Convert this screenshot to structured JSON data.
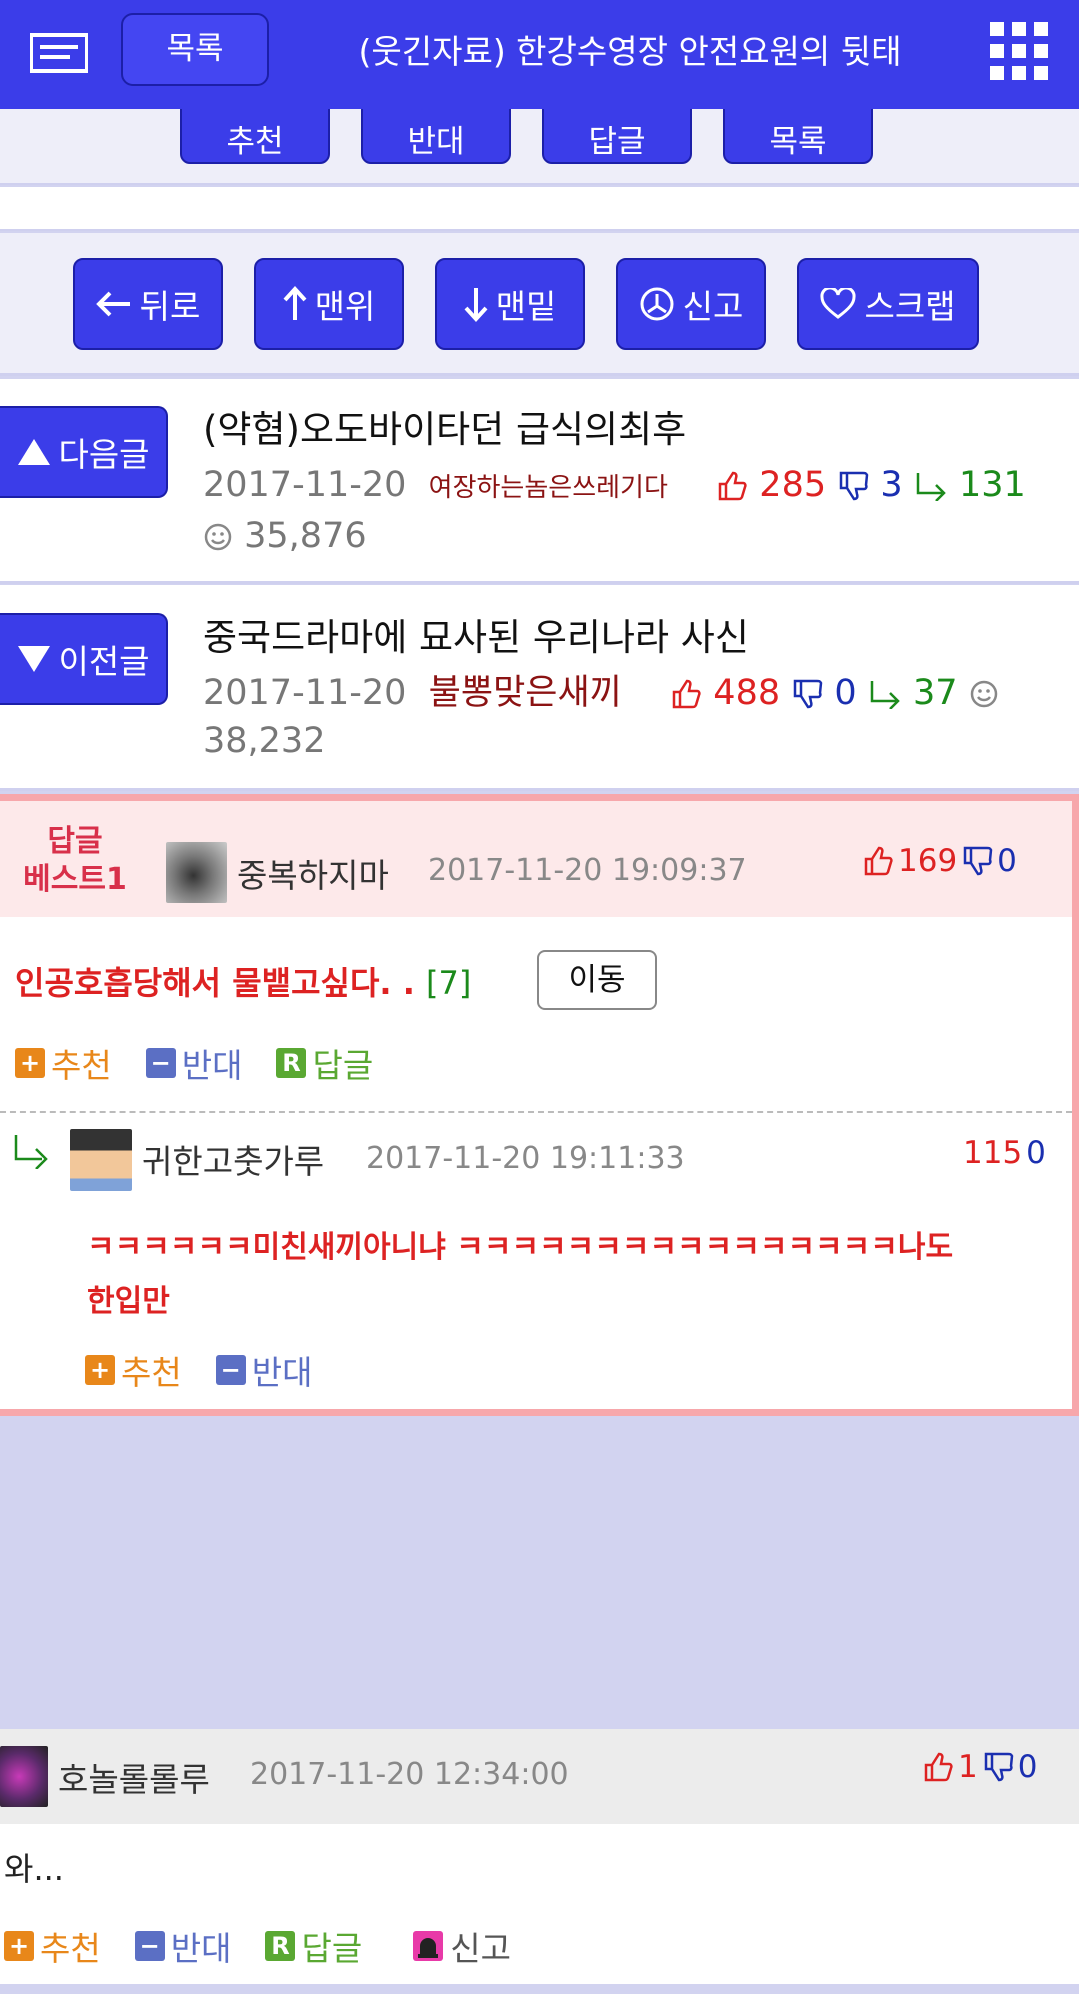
{
  "header": {
    "menu_icon": "hamburger-icon",
    "list_label": "목록",
    "title": "(웃긴자료) 한강수영장 안전요원의 뒷태",
    "grid_icon": "apps-grid-icon"
  },
  "vote_strip": {
    "buttons": [
      "추천",
      "반대",
      "답글",
      "목록"
    ]
  },
  "nav": {
    "back": "뒤로",
    "top": "맨위",
    "bottom": "맨밑",
    "report": "신고",
    "scrap": "스크랩"
  },
  "next_post": {
    "label": "다음글",
    "title": "(약혐)오도바이타던 급식의최후",
    "date": "2017-11-20",
    "author": "여장하는놈은쓰레기다",
    "up": "285",
    "down": "3",
    "replies": "131",
    "views": "35,876"
  },
  "prev_post": {
    "label": "이전글",
    "title": "중국드라마에 묘사된 우리나라 사신",
    "date": "2017-11-20",
    "author": "불뽕맞은새끼",
    "up": "488",
    "down": "0",
    "replies": "37",
    "views": "38,232"
  },
  "best_comment": {
    "label_line1": "답글",
    "label_line2": "베스트1",
    "user": "중복하지마",
    "time": "2017-11-20 19:09:37",
    "up": "169",
    "down": "0",
    "text": "인공호흡당해서 물뱉고싶다. .",
    "reply_count": "[7]",
    "move_label": "이동",
    "actions": {
      "recommend": "추천",
      "oppose": "반대",
      "reply": "답글"
    }
  },
  "reply_comment": {
    "user": "귀한고춧가루",
    "time": "2017-11-20 19:11:33",
    "up": "115",
    "down": "0",
    "text_line1": "ㅋㅋㅋㅋㅋㅋ미친새끼아니냐 ㅋㅋㅋㅋㅋㅋㅋㅋㅋㅋㅋㅋㅋㅋㅋㅋ나도",
    "text_line2": "한입만",
    "actions": {
      "recommend": "추천",
      "oppose": "반대"
    }
  },
  "comment3": {
    "user": "호놀롤롤루",
    "time": "2017-11-20 12:34:00",
    "up": "1",
    "down": "0",
    "text": "와...",
    "actions": {
      "recommend": "추천",
      "oppose": "반대",
      "reply": "답글",
      "report": "신고"
    }
  },
  "colors": {
    "primary": "#3b3de9",
    "best_border": "#f7a7ab",
    "upvote": "#dd2222",
    "downvote": "#1a2fb0",
    "reply_green": "#1b8a1b",
    "recommend_orange": "#e8871a",
    "oppose_blue": "#5b6fc4",
    "reply_badge": "#5aa832"
  }
}
